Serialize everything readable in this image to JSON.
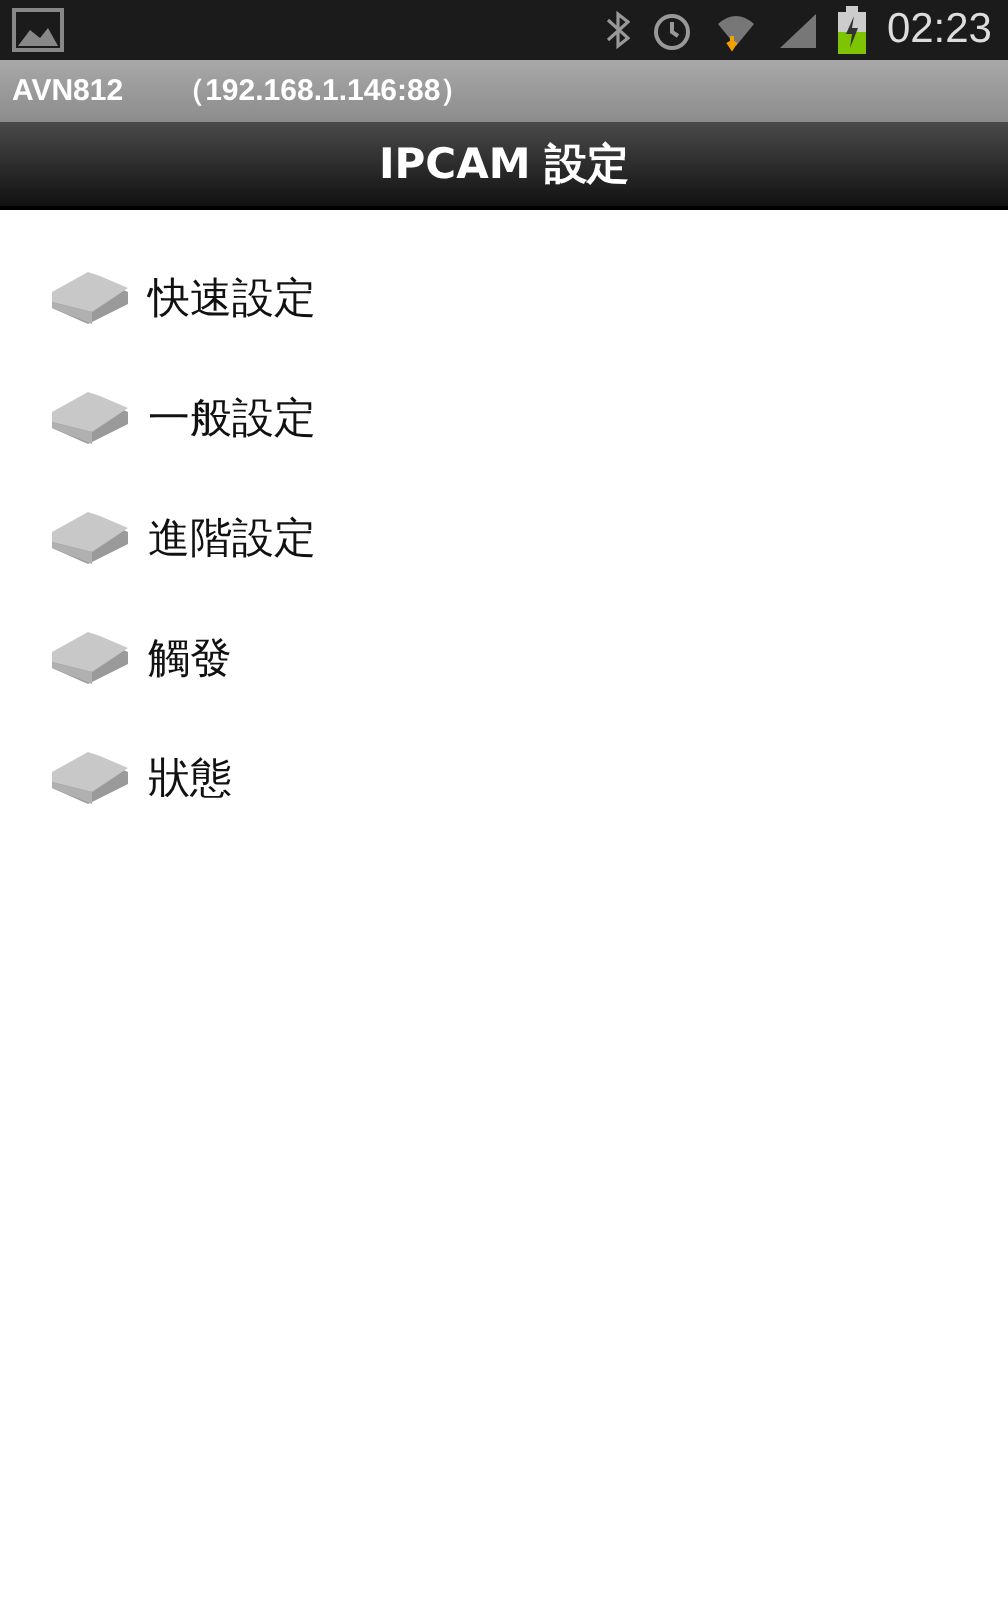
{
  "status_bar": {
    "time": "02:23"
  },
  "connection_bar": {
    "device": "AVN812",
    "address": "（192.168.1.146:88）"
  },
  "title_bar": {
    "title": "IPCAM 設定"
  },
  "menu": {
    "items": [
      {
        "label": "快速設定"
      },
      {
        "label": "一般設定"
      },
      {
        "label": "進階設定"
      },
      {
        "label": "觸發"
      },
      {
        "label": "狀態"
      }
    ]
  }
}
